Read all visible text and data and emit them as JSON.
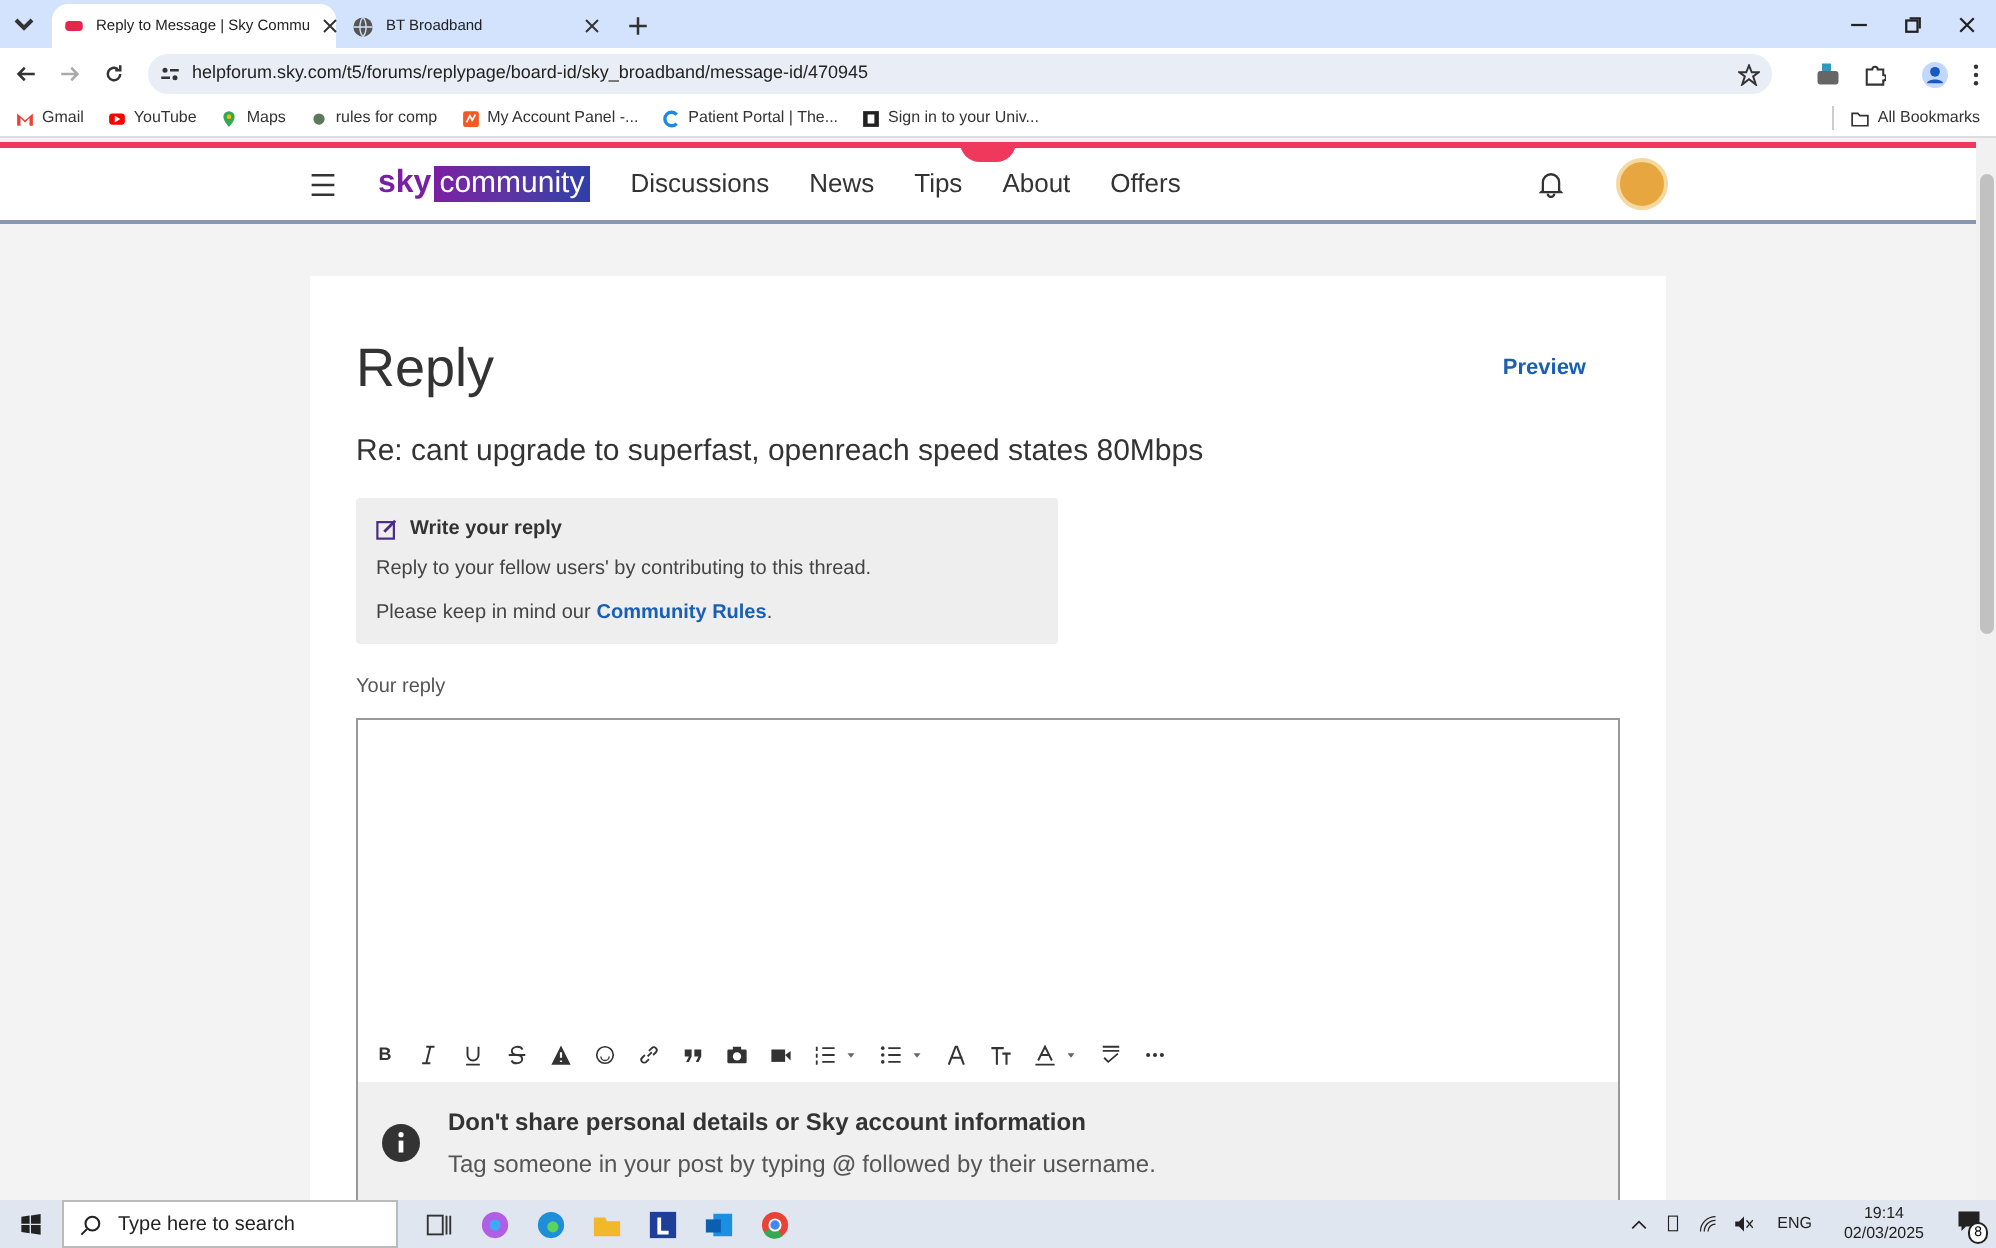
{
  "browser": {
    "tabs": [
      {
        "title": "Reply to Message | Sky Commu",
        "selected": true
      },
      {
        "title": "BT Broadband",
        "selected": false
      }
    ],
    "url": "helpforum.sky.com/t5/forums/replypage/board-id/sky_broadband/message-id/470945",
    "bookmarks": [
      "Gmail",
      "YouTube",
      "Maps",
      "rules for comp",
      "My Account Panel -...",
      "Patient Portal | The...",
      "Sign in to your Univ..."
    ],
    "all_bookmarks": "All Bookmarks"
  },
  "site": {
    "logo_sky": "sky",
    "logo_community": "community",
    "nav": [
      "Discussions",
      "News",
      "Tips",
      "About",
      "Offers"
    ]
  },
  "page": {
    "title": "Reply",
    "preview": "Preview",
    "subject": "Re: cant upgrade to superfast, openreach speed states 80Mbps",
    "info": {
      "heading": "Write your reply",
      "line1": "Reply to your fellow users' by contributing to this thread.",
      "line2_prefix": "Please keep in mind our",
      "line2_link": "Community Rules",
      "line2_suffix": "."
    },
    "reply_label": "Your reply",
    "bold_button": "B",
    "notice": {
      "heading": "Don't share personal details or Sky account information",
      "text": "Tag someone in your post by typing **@** followed by their username."
    }
  },
  "taskbar": {
    "search_placeholder": "Type here to search",
    "language": "ENG",
    "time": "19:14",
    "date": "02/03/2025",
    "notifications": "8"
  }
}
